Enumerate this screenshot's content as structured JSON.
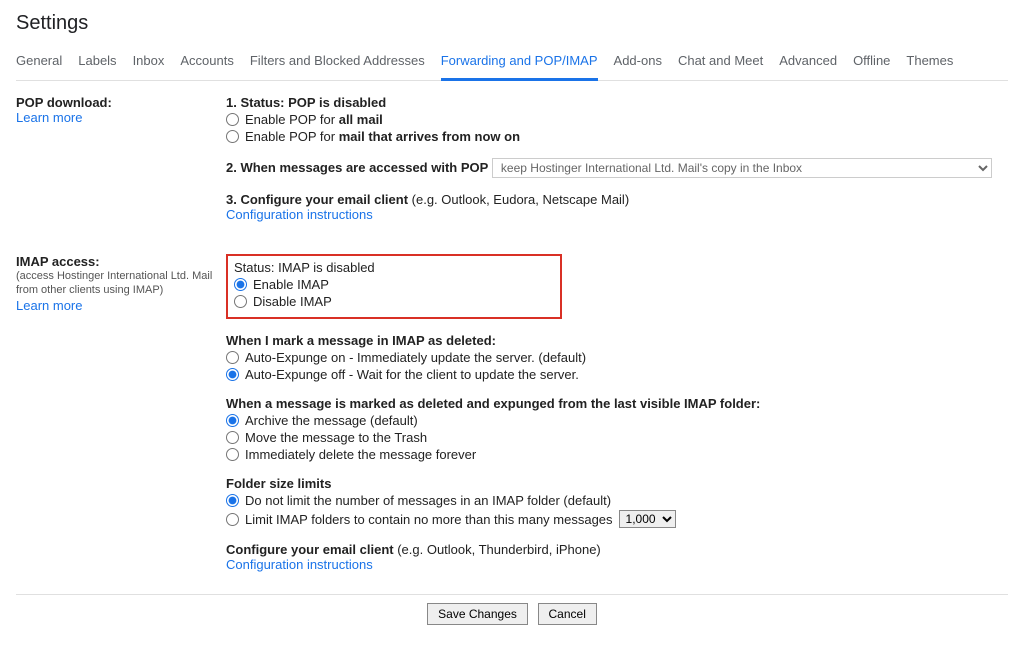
{
  "title": "Settings",
  "tabs": [
    "General",
    "Labels",
    "Inbox",
    "Accounts",
    "Filters and Blocked Addresses",
    "Forwarding and POP/IMAP",
    "Add-ons",
    "Chat and Meet",
    "Advanced",
    "Offline",
    "Themes"
  ],
  "active_tab_index": 5,
  "pop": {
    "left_label": "POP download:",
    "learn_more": "Learn more",
    "status_prefix": "1. Status: ",
    "status_bold": "POP is disabled",
    "opt_all_prefix": "Enable POP for ",
    "opt_all_bold": "all mail",
    "opt_now_prefix": "Enable POP for ",
    "opt_now_bold": "mail that arrives from now on",
    "step2_bold": "2. When messages are accessed with POP",
    "step2_select": "keep Hostinger International Ltd. Mail's copy in the Inbox",
    "step3_bold": "3. Configure your email client",
    "step3_rest": " (e.g. Outlook, Eudora, Netscape Mail)",
    "config_link": "Configuration instructions"
  },
  "imap": {
    "left_label": "IMAP access:",
    "left_sub": "(access Hostinger International Ltd. Mail from other clients using IMAP)",
    "learn_more": "Learn more",
    "status_bold": "Status: IMAP is disabled",
    "enable_label": "Enable IMAP",
    "disable_label": "Disable IMAP",
    "deleted_heading": "When I mark a message in IMAP as deleted:",
    "expunge_on": "Auto-Expunge on - Immediately update the server. (default)",
    "expunge_off": "Auto-Expunge off - Wait for the client to update the server.",
    "expunged_heading": "When a message is marked as deleted and expunged from the last visible IMAP folder:",
    "exp_archive": "Archive the message (default)",
    "exp_trash": "Move the message to the Trash",
    "exp_delete": "Immediately delete the message forever",
    "folder_heading": "Folder size limits",
    "folder_nolimit": "Do not limit the number of messages in an IMAP folder (default)",
    "folder_limit_text": "Limit IMAP folders to contain no more than this many messages",
    "folder_limit_value": "1,000",
    "configure_bold": "Configure your email client",
    "configure_rest": " (e.g. Outlook, Thunderbird, iPhone)",
    "config_link": "Configuration instructions"
  },
  "buttons": {
    "save": "Save Changes",
    "cancel": "Cancel"
  },
  "state": {
    "pop_selected": null,
    "imap_enable": "enable",
    "expunge": "off",
    "expunged_action": "archive",
    "folder_limit": "nolimit"
  }
}
